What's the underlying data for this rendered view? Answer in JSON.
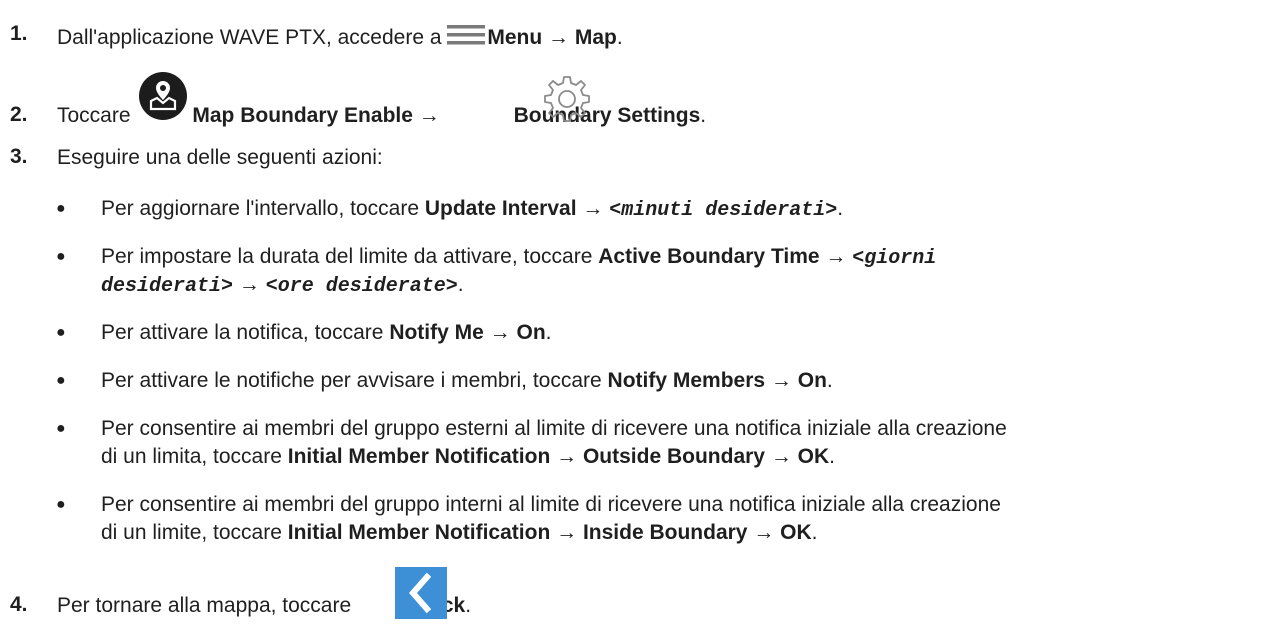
{
  "steps": [
    {
      "number": "1.",
      "pre": "Dall'applicazione WAVE PTX, accedere a ",
      "icon": "menu-icon",
      "b1": "Menu",
      "arrow": " → ",
      "b2": "Map",
      "end": "."
    },
    {
      "number": "2.",
      "pre": "Toccare ",
      "icon1": "map-boundary-icon",
      "b1": "Map Boundary Enable",
      "arrow": " → ",
      "icon2": "gear-icon",
      "b2": "Boundary Settings",
      "end": "."
    },
    {
      "number": "3.",
      "text": "Eseguire una delle seguenti azioni:"
    },
    {
      "number": "4.",
      "pre": "Per tornare alla mappa, toccare ",
      "icon": "back-icon",
      "b1": "Back",
      "end": "."
    }
  ],
  "bullet_char": "●",
  "actions": [
    {
      "pre": "Per aggiornare l'intervallo, toccare ",
      "b1": "Update Interval",
      "arrow": " → ",
      "m1": "<minuti desiderati>",
      "end": "."
    },
    {
      "pre": "Per impostare la durata del limite da attivare, toccare ",
      "b1": "Active Boundary Time",
      "arrow1": " → ",
      "m1": "<giorni",
      "m1b": "desiderati>",
      "arrow2": " → ",
      "m2": "<ore desiderate>",
      "end": "."
    },
    {
      "pre": "Per attivare la notifica, toccare ",
      "b1": "Notify Me",
      "arrow": " → ",
      "b2": "On",
      "end": "."
    },
    {
      "pre": "Per attivare le notifiche per avvisare i membri, toccare ",
      "b1": "Notify Members",
      "arrow": " → ",
      "b2": "On",
      "end": "."
    },
    {
      "line1": "Per consentire ai membri del gruppo esterni al limite di ricevere una notifica iniziale alla creazione",
      "pre": "di un limita, toccare ",
      "b1": "Initial Member Notification",
      "arrow1": " → ",
      "b2": "Outside Boundary",
      "arrow2": " → ",
      "b3": "OK",
      "end": "."
    },
    {
      "line1": "Per consentire ai membri del gruppo interni al limite di ricevere una notifica iniziale alla creazione",
      "pre": "di un limite, toccare ",
      "b1": "Initial Member Notification",
      "arrow1": " → ",
      "b2": "Inside Boundary",
      "arrow2": " → ",
      "b3": "OK",
      "end": "."
    }
  ]
}
